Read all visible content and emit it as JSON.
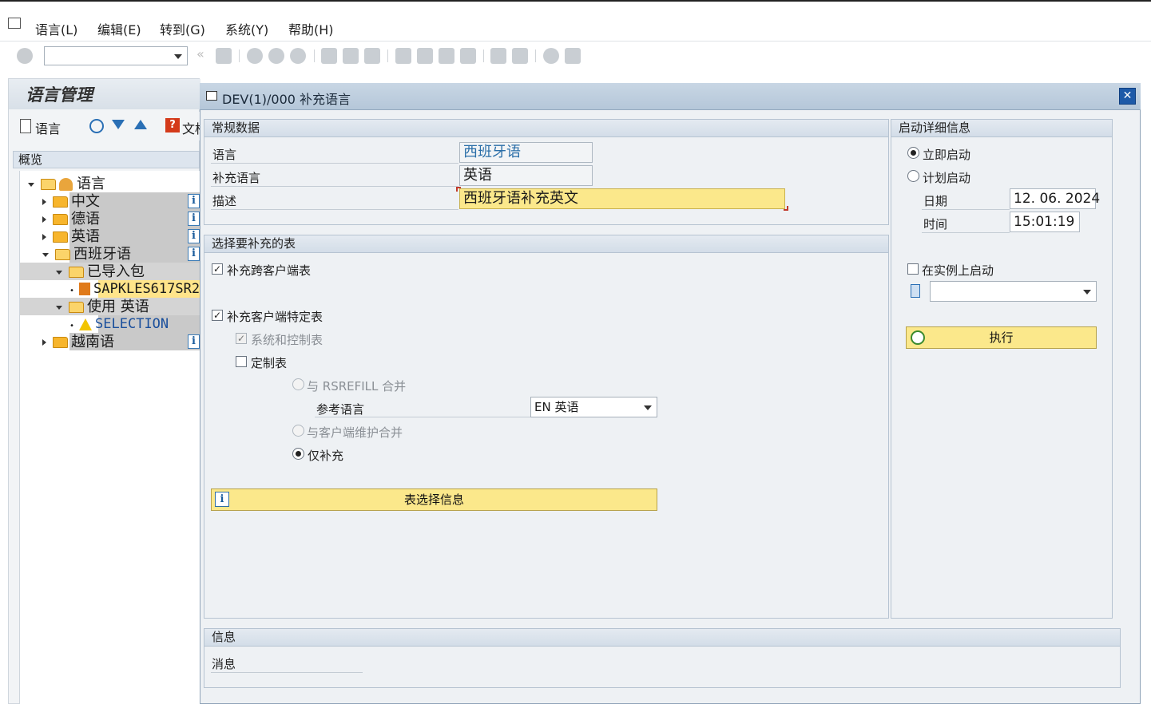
{
  "menubar": {
    "items": [
      "语言(L)",
      "编辑(E)",
      "转到(G)",
      "系统(Y)",
      "帮助(H)"
    ]
  },
  "background": {
    "title": "语言管理",
    "tool_language_label": "语言",
    "tool_docs_label": "文档",
    "tree_header": "概览",
    "tree": {
      "root": "语言",
      "zh": "中文",
      "de": "德语",
      "en": "英语",
      "es": "西班牙语",
      "imported": "已导入包",
      "package": "SAPKLES617SR2",
      "usage": "使用  英语",
      "selection": "SELECTION",
      "vi": "越南语"
    }
  },
  "dialog": {
    "title": "DEV(1)/000 补充语言",
    "close": "✕",
    "general": {
      "header": "常规数据",
      "language_label": "语言",
      "language_value": "西班牙语",
      "supp_language_label": "补充语言",
      "supp_language_value": "英语",
      "description_label": "描述",
      "description_value": "西班牙语补充英文"
    },
    "tables": {
      "header": "选择要补充的表",
      "cross_client": "补充跨客户端表",
      "client_specific": "补充客户端特定表",
      "system_control": "系统和控制表",
      "custom": "定制表",
      "merge_rsrefill": "与 RSREFILL 合并",
      "ref_language_label": "参考语言",
      "ref_language_value": "EN 英语",
      "merge_client": "与客户端维护合并",
      "only_supplement": "仅补充",
      "table_info_button": "表选择信息"
    },
    "start": {
      "header": "启动详细信息",
      "immediate": "立即启动",
      "scheduled": "计划启动",
      "date_label": "日期",
      "date_value": "12. 06. 2024",
      "time_label": "时间",
      "time_value": "15:01:19",
      "instance_label": "在实例上启动",
      "instance_value": "",
      "execute": "执行"
    },
    "info": {
      "header": "信息",
      "message_label": "消息"
    }
  }
}
